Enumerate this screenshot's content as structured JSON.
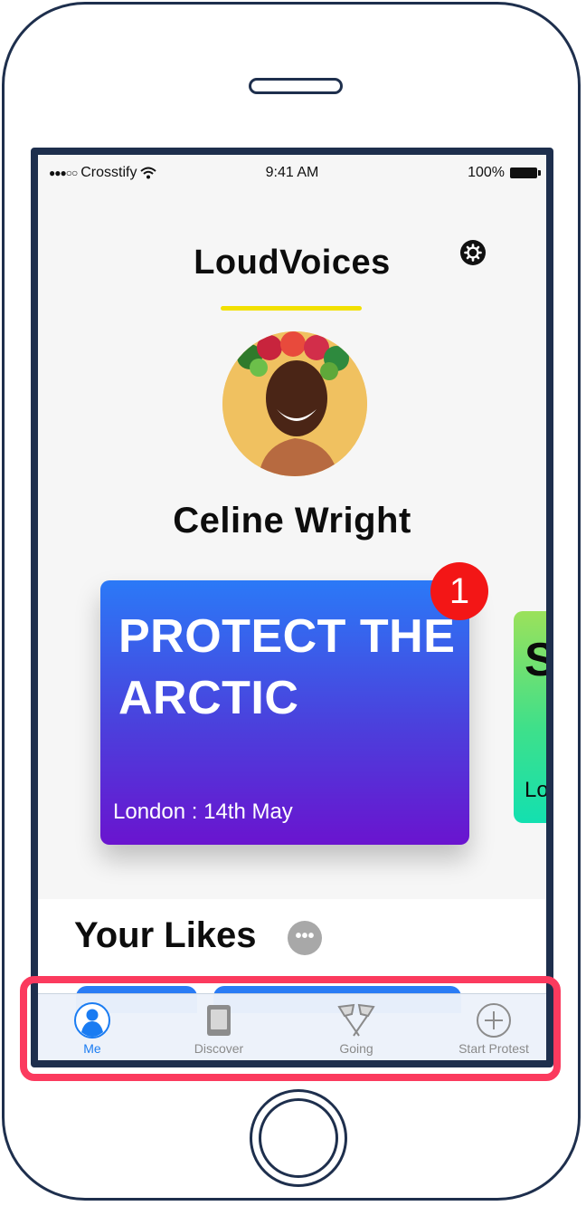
{
  "status_bar": {
    "signal": "●●●○○",
    "carrier": "Crosstify",
    "time": "9:41 AM",
    "battery": "100%"
  },
  "header": {
    "title": "LoudVoices",
    "settings_icon": "gear-icon",
    "underline_color": "#f2e000"
  },
  "profile": {
    "name": "Celine Wright"
  },
  "cards": [
    {
      "title": "PROTECT THE ARCTIC",
      "meta": "London : 14th May",
      "badge": "1"
    },
    {
      "title": "S C",
      "meta": "Lo"
    }
  ],
  "likes": {
    "title": "Your Likes",
    "more_label": "•••"
  },
  "tabs": [
    {
      "label": "Me",
      "icon": "person-icon",
      "active": true
    },
    {
      "label": "Discover",
      "icon": "book-icon",
      "active": false
    },
    {
      "label": "Going",
      "icon": "flags-icon",
      "active": false
    },
    {
      "label": "Start Protest",
      "icon": "plus-circle-icon",
      "active": false
    }
  ],
  "colors": {
    "accent": "#1a7cf2",
    "badge": "#f31616",
    "highlight": "#fb3a5e",
    "frame": "#1e2f4d"
  }
}
